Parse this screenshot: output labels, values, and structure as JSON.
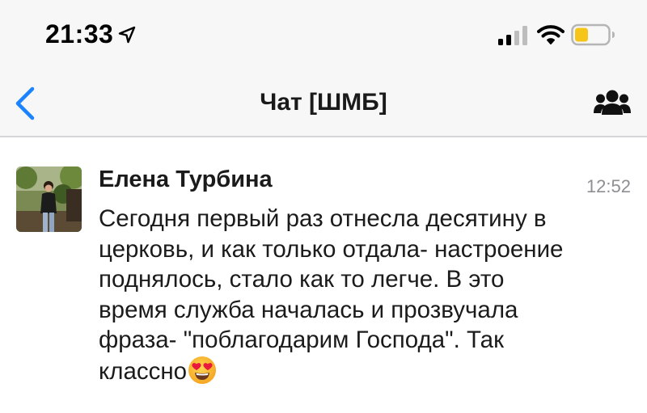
{
  "status_bar": {
    "time": "21:33",
    "icons": [
      "location-arrow-icon",
      "cellular-signal-icon",
      "wifi-icon",
      "battery-icon"
    ],
    "battery_color": "#f5c518"
  },
  "nav": {
    "title": "Чат [ШМБ]",
    "back_icon": "chevron-left-icon",
    "group_icon": "group-icon",
    "accent_color": "#1a84ff"
  },
  "message": {
    "sender": "Елена Турбина",
    "time": "12:52",
    "text_lines": [
      "Сегодня первый раз отнесла десятину в",
      "церковь, и как только отдала- настроение",
      "поднялось, стало как то легче. В это",
      "время служба началась и прозвучала",
      "фраза- \"поблагодарим Господа\". Так",
      "классно"
    ],
    "emoji": "heart-eyes-emoji"
  }
}
